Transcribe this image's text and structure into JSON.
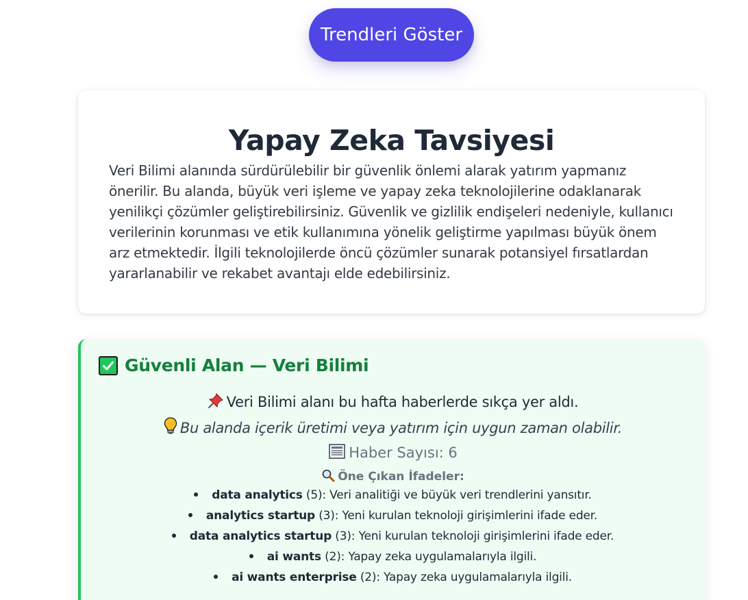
{
  "trend_button": {
    "label": "Trendleri Göster"
  },
  "advice": {
    "title": "Yapay Zeka Tavsiyesi",
    "text": "Veri Bilimi alanında sürdürülebilir bir güvenlik önlemi alarak yatırım yapmanız önerilir. Bu alanda, büyük veri işleme ve yapay zeka teknolojilerine odaklanarak yenilikçi çözümler geliştirebilirsiniz. Güvenlik ve gizlilik endişeleri nedeniyle, kullanıcı verilerinin korunması ve etik kullanımına yönelik geliştirme yapılması büyük önem arz etmektedir. İlgili teknolojilerde öncü çözümler sunarak potansiyel fırsatlardan yararlanabilir ve rekabet avantajı elde edebilirsiniz."
  },
  "safe_area": {
    "icon": "check-icon",
    "title": "Güvenli Alan — Veri Bilimi",
    "news_line": {
      "icon": "pushpin-icon",
      "text": "Veri Bilimi alanı bu hafta haberlerde sıkça yer aldı."
    },
    "tip_line": {
      "icon": "lightbulb-icon",
      "text": "Bu alanda içerik üretimi veya yatırım için uygun zaman olabilir."
    },
    "count_line": {
      "icon": "newspaper-icon",
      "text": "Haber Sayısı: 6"
    },
    "phrases_heading": {
      "icon": "magnifier-icon",
      "text": "Öne Çıkan İfadeler:"
    },
    "phrases": [
      {
        "term": "data analytics",
        "count": "(5)",
        "desc": ": Veri analitiği ve büyük veri trendlerini yansıtır."
      },
      {
        "term": "analytics startup",
        "count": "(3)",
        "desc": ": Yeni kurulan teknoloji girişimlerini ifade eder."
      },
      {
        "term": "data analytics startup",
        "count": "(3)",
        "desc": ": Yeni kurulan teknoloji girişimlerini ifade eder."
      },
      {
        "term": "ai wants",
        "count": "(2)",
        "desc": ": Yapay zeka uygulamalarıyla ilgili."
      },
      {
        "term": "ai wants enterprise",
        "count": "(2)",
        "desc": ": Yapay zeka uygulamalarıyla ilgili."
      }
    ]
  },
  "colors": {
    "accent": "#4f46e5",
    "safe_green": "#22c55e",
    "safe_title": "#15803d",
    "safe_bg": "#eefcf3"
  }
}
